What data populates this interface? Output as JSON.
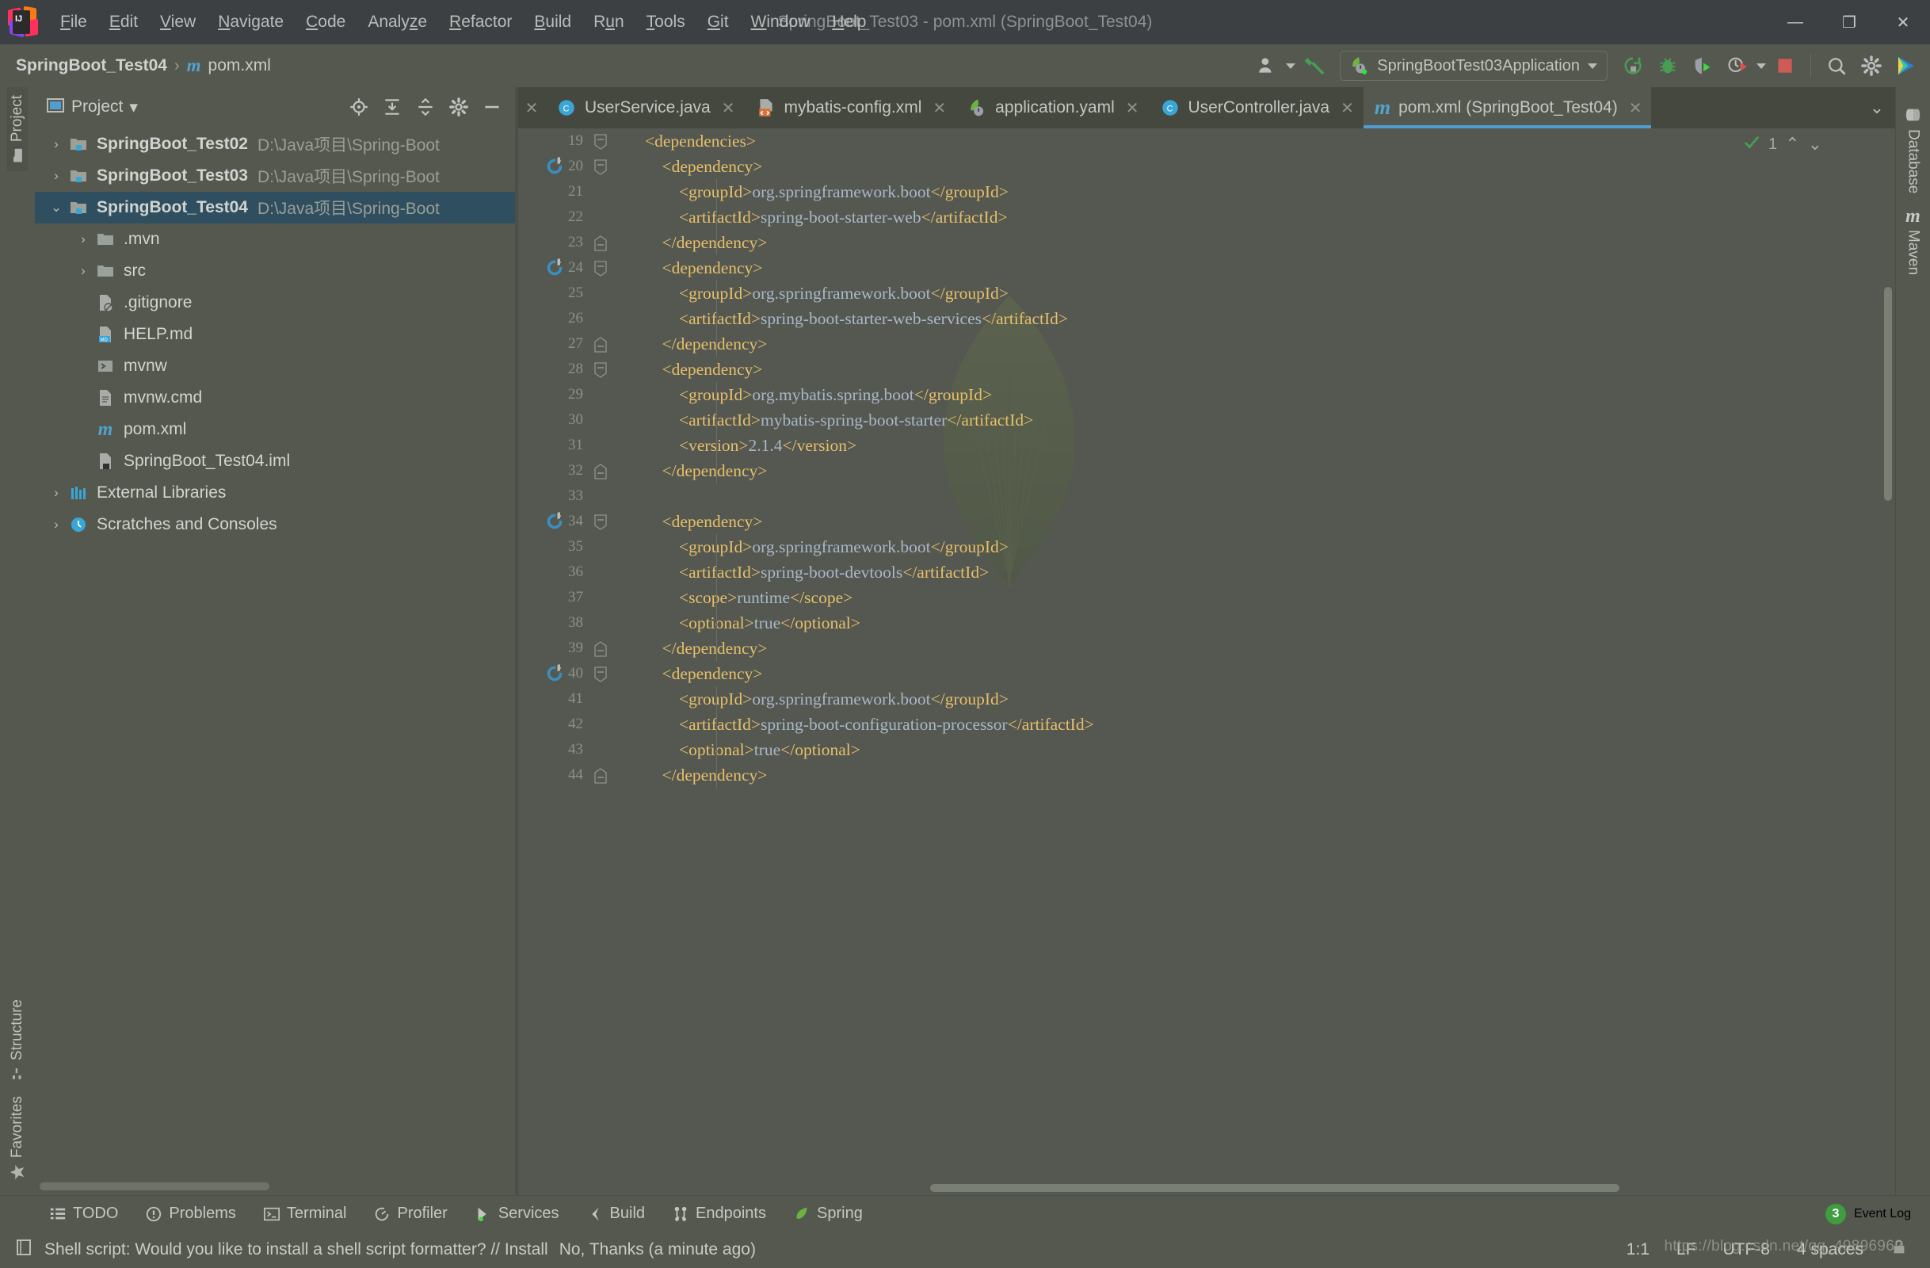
{
  "window": {
    "title": "SpringBoot_Test03 - pom.xml (SpringBoot_Test04)",
    "minimize": "—",
    "maximize": "❐",
    "close": "✕"
  },
  "menubar": {
    "items": [
      {
        "label": "File",
        "mnemonic": "F"
      },
      {
        "label": "Edit",
        "mnemonic": "E"
      },
      {
        "label": "View",
        "mnemonic": "V"
      },
      {
        "label": "Navigate",
        "mnemonic": "N"
      },
      {
        "label": "Code",
        "mnemonic": "C"
      },
      {
        "label": "Analyze",
        "mnemonic": "z"
      },
      {
        "label": "Refactor",
        "mnemonic": "R"
      },
      {
        "label": "Build",
        "mnemonic": "B"
      },
      {
        "label": "Run",
        "mnemonic": "u"
      },
      {
        "label": "Tools",
        "mnemonic": "T"
      },
      {
        "label": "Git",
        "mnemonic": "G"
      },
      {
        "label": "Window",
        "mnemonic": "W"
      },
      {
        "label": "Help",
        "mnemonic": "H"
      }
    ]
  },
  "toolbar": {
    "breadcrumb": {
      "project": "SpringBoot_Test04",
      "separator": "›",
      "file": "pom.xml",
      "file_icon": "maven-m-icon"
    },
    "run_config": "SpringBootTest03Application",
    "icons": [
      "user-account-icon",
      "build-hammer-icon",
      "rerun-icon",
      "debug-icon",
      "coverage-icon",
      "profiler-run-icon",
      "stop-icon",
      "search-everywhere-icon",
      "settings-gear-icon",
      "updates-icon"
    ]
  },
  "left_tool_window_bar": {
    "top": [
      {
        "label": "Project",
        "icon": "project-folder-icon",
        "selected": true
      }
    ],
    "bottom": [
      {
        "label": "Structure",
        "icon": "structure-icon",
        "selected": false
      },
      {
        "label": "Favorites",
        "icon": "star-icon",
        "selected": false
      }
    ]
  },
  "right_tool_window_bar": {
    "items": [
      {
        "label": "Database",
        "icon": "database-icon"
      },
      {
        "label": "Maven",
        "icon": "maven-m-icon"
      }
    ]
  },
  "project_panel": {
    "title": "Project",
    "title_caret": "▾",
    "header_icons": [
      "locate-icon",
      "expand-all-icon",
      "collapse-all-icon",
      "gear-icon",
      "hide-icon"
    ],
    "tree": [
      {
        "indent": 0,
        "twisty": "›",
        "icon": "module-folder-icon",
        "label": "SpringBoot_Test02",
        "bold": true,
        "path": "D:\\Java项目\\Spring-Boot",
        "selected": false
      },
      {
        "indent": 0,
        "twisty": "›",
        "icon": "module-folder-icon",
        "label": "SpringBoot_Test03",
        "bold": true,
        "path": "D:\\Java项目\\Spring-Boot",
        "selected": false
      },
      {
        "indent": 0,
        "twisty": "⌄",
        "icon": "module-folder-icon",
        "label": "SpringBoot_Test04",
        "bold": true,
        "path": "D:\\Java项目\\Spring-Boot",
        "selected": true
      },
      {
        "indent": 1,
        "twisty": "›",
        "icon": "folder-icon",
        "label": ".mvn",
        "bold": false,
        "path": "",
        "selected": false
      },
      {
        "indent": 1,
        "twisty": "›",
        "icon": "folder-icon",
        "label": "src",
        "bold": false,
        "path": "",
        "selected": false
      },
      {
        "indent": 1,
        "twisty": "",
        "icon": "gitignore-file-icon",
        "label": ".gitignore",
        "bold": false,
        "path": "",
        "selected": false
      },
      {
        "indent": 1,
        "twisty": "",
        "icon": "markdown-file-icon",
        "label": "HELP.md",
        "bold": false,
        "path": "",
        "selected": false
      },
      {
        "indent": 1,
        "twisty": "",
        "icon": "shell-script-icon",
        "label": "mvnw",
        "bold": false,
        "path": "",
        "selected": false
      },
      {
        "indent": 1,
        "twisty": "",
        "icon": "text-file-icon",
        "label": "mvnw.cmd",
        "bold": false,
        "path": "",
        "selected": false
      },
      {
        "indent": 1,
        "twisty": "",
        "icon": "maven-m-icon",
        "label": "pom.xml",
        "bold": false,
        "path": "",
        "selected": false
      },
      {
        "indent": 1,
        "twisty": "",
        "icon": "iml-file-icon",
        "label": "SpringBoot_Test04.iml",
        "bold": false,
        "path": "",
        "selected": false
      },
      {
        "indent": 0,
        "twisty": "›",
        "icon": "libraries-icon",
        "label": "External Libraries",
        "bold": false,
        "path": "",
        "selected": false
      },
      {
        "indent": 0,
        "twisty": "›",
        "icon": "scratches-icon",
        "label": "Scratches and Consoles",
        "bold": false,
        "path": "",
        "selected": false
      }
    ]
  },
  "editor_tabs": [
    {
      "label": "UserService.java",
      "icon": "java-class-icon",
      "active": false,
      "close": "✕"
    },
    {
      "label": "mybatis-config.xml",
      "icon": "xml-file-icon",
      "active": false,
      "close": "✕"
    },
    {
      "label": "application.yaml",
      "icon": "spring-yaml-icon",
      "active": false,
      "close": "✕"
    },
    {
      "label": "UserController.java",
      "icon": "java-class-icon",
      "active": false,
      "close": "✕"
    },
    {
      "label": "pom.xml (SpringBoot_Test04)",
      "icon": "maven-m-icon",
      "active": true,
      "close": "✕"
    }
  ],
  "editor": {
    "inspection_count": "1",
    "inspection_icon": "inspections-ok-icon",
    "up_arrow": "⌃",
    "down_arrow": "⌄",
    "tabs_overflow": "⌄",
    "first_line_number": 19,
    "lines": [
      {
        "n": 19,
        "indent": 1,
        "fold": "minus-square",
        "gutter_mark": "",
        "text": "<dependencies>"
      },
      {
        "n": 20,
        "indent": 2,
        "fold": "minus-square",
        "gutter_mark": "maven-dep-icon",
        "text": "    <dependency>"
      },
      {
        "n": 21,
        "indent": 3,
        "fold": "",
        "gutter_mark": "",
        "text": "        <groupId>org.springframework.boot</groupId>"
      },
      {
        "n": 22,
        "indent": 3,
        "fold": "",
        "gutter_mark": "",
        "text": "        <artifactId>spring-boot-starter-web</artifactId>"
      },
      {
        "n": 23,
        "indent": 2,
        "fold": "minus-square-end",
        "gutter_mark": "",
        "text": "    </dependency>"
      },
      {
        "n": 24,
        "indent": 2,
        "fold": "minus-square",
        "gutter_mark": "maven-dep-icon",
        "text": "    <dependency>"
      },
      {
        "n": 25,
        "indent": 3,
        "fold": "",
        "gutter_mark": "",
        "text": "        <groupId>org.springframework.boot</groupId>"
      },
      {
        "n": 26,
        "indent": 3,
        "fold": "",
        "gutter_mark": "",
        "text": "        <artifactId>spring-boot-starter-web-services</artifactId>"
      },
      {
        "n": 27,
        "indent": 2,
        "fold": "minus-square-end",
        "gutter_mark": "",
        "text": "    </dependency>"
      },
      {
        "n": 28,
        "indent": 2,
        "fold": "minus-square",
        "gutter_mark": "",
        "text": "    <dependency>"
      },
      {
        "n": 29,
        "indent": 3,
        "fold": "",
        "gutter_mark": "",
        "text": "        <groupId>org.mybatis.spring.boot</groupId>"
      },
      {
        "n": 30,
        "indent": 3,
        "fold": "",
        "gutter_mark": "",
        "text": "        <artifactId>mybatis-spring-boot-starter</artifactId>"
      },
      {
        "n": 31,
        "indent": 3,
        "fold": "",
        "gutter_mark": "",
        "text": "        <version>2.1.4</version>"
      },
      {
        "n": 32,
        "indent": 2,
        "fold": "minus-square-end",
        "gutter_mark": "",
        "text": "    </dependency>"
      },
      {
        "n": 33,
        "indent": 0,
        "fold": "",
        "gutter_mark": "",
        "text": ""
      },
      {
        "n": 34,
        "indent": 2,
        "fold": "minus-square",
        "gutter_mark": "maven-dep-icon",
        "text": "    <dependency>"
      },
      {
        "n": 35,
        "indent": 3,
        "fold": "",
        "gutter_mark": "",
        "text": "        <groupId>org.springframework.boot</groupId>"
      },
      {
        "n": 36,
        "indent": 3,
        "fold": "",
        "gutter_mark": "",
        "text": "        <artifactId>spring-boot-devtools</artifactId>"
      },
      {
        "n": 37,
        "indent": 3,
        "fold": "",
        "gutter_mark": "",
        "text": "        <scope>runtime</scope>"
      },
      {
        "n": 38,
        "indent": 3,
        "fold": "",
        "gutter_mark": "",
        "text": "        <optional>true</optional>"
      },
      {
        "n": 39,
        "indent": 2,
        "fold": "minus-square-end",
        "gutter_mark": "",
        "text": "    </dependency>"
      },
      {
        "n": 40,
        "indent": 2,
        "fold": "minus-square",
        "gutter_mark": "maven-dep-icon",
        "text": "    <dependency>"
      },
      {
        "n": 41,
        "indent": 3,
        "fold": "",
        "gutter_mark": "",
        "text": "        <groupId>org.springframework.boot</groupId>"
      },
      {
        "n": 42,
        "indent": 3,
        "fold": "",
        "gutter_mark": "",
        "text": "        <artifactId>spring-boot-configuration-processor</artifactId>"
      },
      {
        "n": 43,
        "indent": 3,
        "fold": "",
        "gutter_mark": "",
        "text": "        <optional>true</optional>"
      },
      {
        "n": 44,
        "indent": 2,
        "fold": "minus-square-end",
        "gutter_mark": "",
        "text": "    </dependency>"
      }
    ]
  },
  "bottom_tool_bar": {
    "items": [
      {
        "label": "TODO",
        "icon": "todo-icon"
      },
      {
        "label": "Problems",
        "icon": "problems-icon"
      },
      {
        "label": "Terminal",
        "icon": "terminal-icon"
      },
      {
        "label": "Profiler",
        "icon": "profiler-icon"
      },
      {
        "label": "Services",
        "icon": "services-icon"
      },
      {
        "label": "Build",
        "icon": "build-icon"
      },
      {
        "label": "Endpoints",
        "icon": "endpoints-icon"
      },
      {
        "label": "Spring",
        "icon": "spring-leaf-icon"
      }
    ],
    "event_log": {
      "label": "Event Log",
      "count": "3"
    }
  },
  "status_bar": {
    "icon": "notification-icon",
    "message": "Shell script: Would you like to install a shell script formatter? // Install",
    "action_secondary": "No, Thanks (a minute ago)",
    "caret_position": "1:1",
    "line_separator": "LF",
    "encoding": "UTF-8",
    "indent": "4 spaces",
    "lock_icon": "lock-icon",
    "watermark": "https://blog.csdn.net/qq_49896962"
  },
  "colors": {
    "accent_blue": "#4f9dd1",
    "tag_orange": "#e8bf6a",
    "text_blue": "#a9b7c6",
    "selection": "#2f4f60",
    "bg_panel": "#54584f",
    "bg_dark": "#3c4043",
    "green": "#3f9c3f"
  }
}
